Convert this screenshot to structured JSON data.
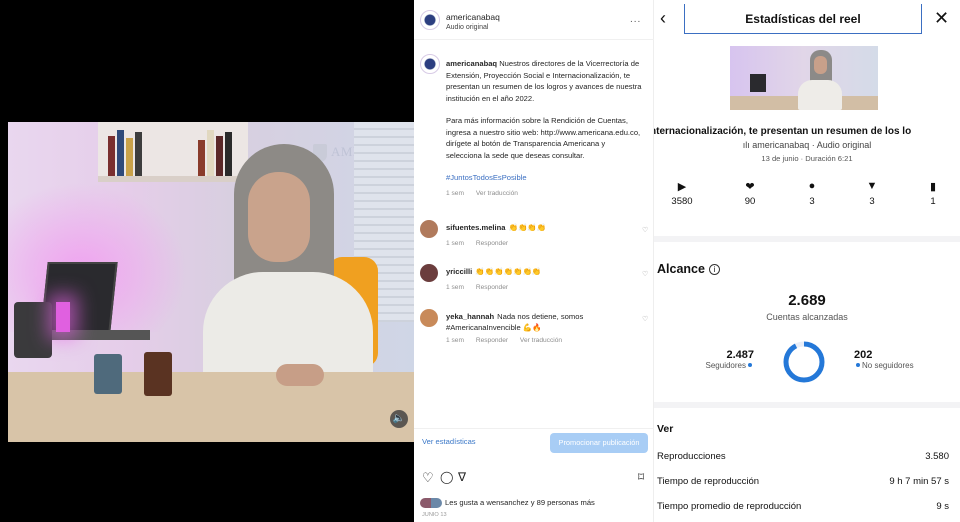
{
  "post": {
    "username": "americanabaq",
    "audio": "Audio original",
    "more": "...",
    "caption_user": "americanabaq",
    "caption_p1": "Nuestros directores de la Vicerrectoría de Extensión, Proyección Social e Internacionalización, te presentan un resumen de los logros y avances de nuestra institución en el año 2022.",
    "caption_p2": "Para más información sobre la Rendición de Cuentas, ingresa a nuestro sitio web: http://www.americana.edu.co, dirígete al botón de Transparencia Americana y selecciona la sede que deseas consultar.",
    "hashtag": "#JuntosTodosEsPosible",
    "caption_time": "1 sem",
    "see_translation": "Ver traducción",
    "comments": [
      {
        "user": "sifuentes.melina",
        "text": "👏👏👏👏",
        "time": "1 sem",
        "reply": "Responder",
        "translate": ""
      },
      {
        "user": "yriccilli",
        "text": "👏👏👏👏👏👏👏",
        "time": "1 sem",
        "reply": "Responder",
        "translate": ""
      },
      {
        "user": "yeka_hannah",
        "text": "Nada nos detiene, somos #AmericanaInvencible 💪🔥",
        "time": "1 sem",
        "reply": "Responder",
        "translate": "Ver traducción"
      }
    ],
    "view_stats": "Ver estadísticas",
    "promote": "Promocionar publicación",
    "likes_text": "Les gusta a wensanchez y 89 personas más",
    "date": "JUNIO 13"
  },
  "video": {
    "wall_logo": "AMERICANA",
    "volume_icon": "speaker-icon"
  },
  "stats": {
    "title": "Estadísticas del reel",
    "back_icon": "chevron-left-icon",
    "close_icon": "close-icon",
    "reel_caption": "nternacionalización, te presentan un resumen de los lo",
    "reel_audio": "ılı americanabaq · Audio original",
    "reel_date": "13 de junio · Duración 6:21",
    "metrics": [
      {
        "icon": "play-icon",
        "value": "3580"
      },
      {
        "icon": "heart-icon",
        "value": "90"
      },
      {
        "icon": "comment-icon",
        "value": "3"
      },
      {
        "icon": "send-icon",
        "value": "3"
      },
      {
        "icon": "bookmark-icon",
        "value": "1"
      }
    ],
    "reach_title": "Alcance",
    "reach_total": "2.689",
    "reach_label": "Cuentas alcanzadas",
    "followers_value": "2.487",
    "followers_label": "Seguidores",
    "nonfollowers_value": "202",
    "nonfollowers_label": "No seguidores",
    "followers_fraction": 0.925,
    "accent": "#2478d8",
    "ver_title": "Ver",
    "ver_rows": [
      {
        "label": "Reproducciones",
        "value": "3.580"
      },
      {
        "label": "Tiempo de reproducción",
        "value": "9 h 7 min 57 s"
      },
      {
        "label": "Tiempo promedio de reproducción",
        "value": "9 s"
      }
    ]
  }
}
